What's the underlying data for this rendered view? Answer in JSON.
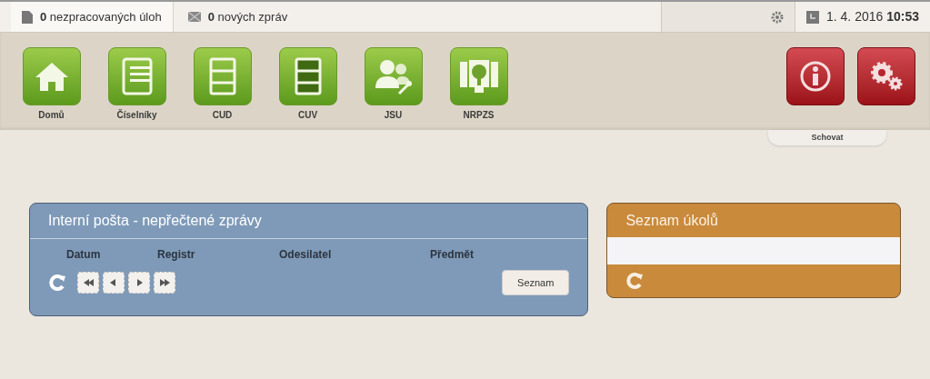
{
  "top_bar": {
    "tasks": "**0** nezpracovaných úloh",
    "messages": "**0** nových zpráv",
    "datetime": "1. 4. 2016 **10:53**"
  },
  "modules": [
    {
      "kind": "home",
      "label": "Domů"
    },
    {
      "kind": "codes",
      "label": "Číselníky"
    },
    {
      "kind": "cud",
      "label": "CUD"
    },
    {
      "kind": "cuv",
      "label": "CUV"
    },
    {
      "kind": "users",
      "label": "JSU"
    },
    {
      "kind": "tree",
      "label": "NRPZS"
    }
  ],
  "tools": [
    {
      "kind": "info"
    },
    {
      "kind": "settings"
    }
  ],
  "hide_tab": "Schovat",
  "mail_panel": {
    "title": "Interní pošta - nepřečtené zprávy",
    "columns": [
      "Datum",
      "Registr",
      "Odesilatel",
      "Předmět"
    ],
    "pager": [
      {
        "kind": "first"
      },
      {
        "kind": "prev"
      },
      {
        "kind": "next"
      },
      {
        "kind": "last"
      }
    ],
    "list_button": "Seznam"
  },
  "tasks_panel": {
    "title": "Seznam úkolů"
  }
}
